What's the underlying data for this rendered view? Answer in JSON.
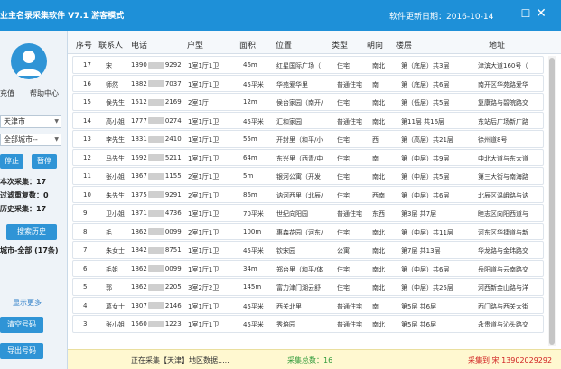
{
  "titlebar": {
    "title": "业主名录采集软件 V7.1  游客模式",
    "update_label": "软件更新日期：2016-10-14",
    "min_symbol": "—",
    "max_symbol": "☐",
    "close_symbol": "✕"
  },
  "sidebar": {
    "link_left": "充值",
    "link_right": "帮助中心",
    "city_select": "天津市",
    "district_select": "全部城市--",
    "stop_btn": "停止",
    "pause_btn": "暂停",
    "stat_collected": "本次采集：17",
    "stat_filtered": "过滤重复数：0",
    "stat_history": "历史采集：17",
    "search_history_btn": "搜索历史",
    "filter_label": "城市-全部 (17条)",
    "show_more": "显示更多",
    "clear_btn": "清空号码",
    "export_btn": "导出号码"
  },
  "table": {
    "headers": [
      "序号",
      "联系人",
      "电话",
      "户型",
      "面积",
      "位置",
      "类型",
      "朝向",
      "楼层",
      "地址"
    ],
    "rows": [
      {
        "no": "17",
        "name": "宋",
        "phone_a": "1390",
        "phone_b": "9292",
        "layout": "1室1厅1卫",
        "area": "46m",
        "loc": "红星国际广场（",
        "type": "住宅",
        "dir": "南北",
        "floor": "第（底层）共3层",
        "addr": "津滨大道160号（东"
      },
      {
        "no": "16",
        "name": "师然",
        "phone_a": "1882",
        "phone_b": "7037",
        "layout": "1室1厅1卫",
        "area": "45平米",
        "loc": "华苑爱华里",
        "type": "普通住宅",
        "dir": "南",
        "floor": "第（底层）共6层",
        "addr": "南开区华苑路爱华"
      },
      {
        "no": "15",
        "name": "侯先生",
        "phone_a": "1512",
        "phone_b": "2169",
        "layout": "2室1厅",
        "area": "12m",
        "loc": "侯台家园（南开/",
        "type": "住宅",
        "dir": "南北",
        "floor": "第（低层）共5层",
        "addr": "复康路与碧皖路交"
      },
      {
        "no": "14",
        "name": "高小姐",
        "phone_a": "1777",
        "phone_b": "0274",
        "layout": "1室1厅1卫",
        "area": "45平米",
        "loc": "汇和家园",
        "type": "普通住宅",
        "dir": "南北",
        "floor": "第11层 共16层",
        "addr": "东站后广场新广路"
      },
      {
        "no": "13",
        "name": "李先生",
        "phone_a": "1831",
        "phone_b": "2410",
        "layout": "1室1厅1卫",
        "area": "55m",
        "loc": "开封里（和平/小",
        "type": "住宅",
        "dir": "西",
        "floor": "第（高层）共21层",
        "addr": "徐州道8号"
      },
      {
        "no": "12",
        "name": "马先生",
        "phone_a": "1592",
        "phone_b": "5211",
        "layout": "1室1厅1卫",
        "area": "64m",
        "loc": "东兴里（西青/中",
        "type": "住宅",
        "dir": "南",
        "floor": "第（中层）共9层",
        "addr": "中北大道与东大道"
      },
      {
        "no": "11",
        "name": "张小姐",
        "phone_a": "1367",
        "phone_b": "1155",
        "layout": "2室1厅1卫",
        "area": "5m",
        "loc": "银河公寓（开发",
        "type": "住宅",
        "dir": "南北",
        "floor": "第（中层）共5层",
        "addr": "第三大街与南海路"
      },
      {
        "no": "10",
        "name": "朱先生",
        "phone_a": "1375",
        "phone_b": "9291",
        "layout": "2室1厅1卫",
        "area": "86m",
        "loc": "讷河西里（北辰/",
        "type": "住宅",
        "dir": "西南",
        "floor": "第（中层）共6层",
        "addr": "北辰区温峨路与讷"
      },
      {
        "no": "9",
        "name": "卫小姐",
        "phone_a": "1871",
        "phone_b": "4736",
        "layout": "1室1厅1卫",
        "area": "70平米",
        "loc": "世纪向阳园",
        "type": "普通住宅",
        "dir": "东西",
        "floor": "第3层 共7层",
        "addr": "睦志区向阳西道与"
      },
      {
        "no": "8",
        "name": "毛",
        "phone_a": "1862",
        "phone_b": "0099",
        "layout": "2室1厅1卫",
        "area": "100m",
        "loc": "惠森花园（河东/",
        "type": "住宅",
        "dir": "南北",
        "floor": "第（中层）共11层",
        "addr": "河东区华捷道与新"
      },
      {
        "no": "7",
        "name": "朱女士",
        "phone_a": "1842",
        "phone_b": "8751",
        "layout": "1室1厅1卫",
        "area": "45平米",
        "loc": "钦宋园",
        "type": "公寓",
        "dir": "南北",
        "floor": "第7层 共13层",
        "addr": "华龙路与金玮路交"
      },
      {
        "no": "6",
        "name": "毛姐",
        "phone_a": "1862",
        "phone_b": "0099",
        "layout": "1室1厅1卫",
        "area": "34m",
        "loc": "郑台里（和平/体",
        "type": "住宅",
        "dir": "南北",
        "floor": "第（中层）共6层",
        "addr": "岳阳道与云南路交"
      },
      {
        "no": "5",
        "name": "郭",
        "phone_a": "1862",
        "phone_b": "2205",
        "layout": "3室2厅2卫",
        "area": "145m",
        "loc": "富力津门湖云舒",
        "type": "住宅",
        "dir": "南北",
        "floor": "第（中层）共25层",
        "addr": "河西新金山路与洋"
      },
      {
        "no": "4",
        "name": "葛女士",
        "phone_a": "1307",
        "phone_b": "2146",
        "layout": "1室1厅1卫",
        "area": "45平米",
        "loc": "西关北里",
        "type": "普通住宅",
        "dir": "南",
        "floor": "第5层 共6层",
        "addr": "西门路与西关大街"
      },
      {
        "no": "3",
        "name": "张小姐",
        "phone_a": "1560",
        "phone_b": "1223",
        "layout": "1室1厅1卫",
        "area": "45平米",
        "loc": "秀培园",
        "type": "普通住宅",
        "dir": "南北",
        "floor": "第5层 共6层",
        "addr": "永贵道与沁头路交"
      }
    ]
  },
  "status": {
    "progress_text": "正在采集【天津】地区数据.....",
    "total_label": "采集总数：16",
    "current_label": "采集到 宋 13902029292"
  },
  "colors": {
    "titlebar": "#1e90d8",
    "accent": "#2f94d6",
    "status_bg": "#fff8d0",
    "total_color": "#2f9a3a",
    "current_color": "#d02020"
  }
}
